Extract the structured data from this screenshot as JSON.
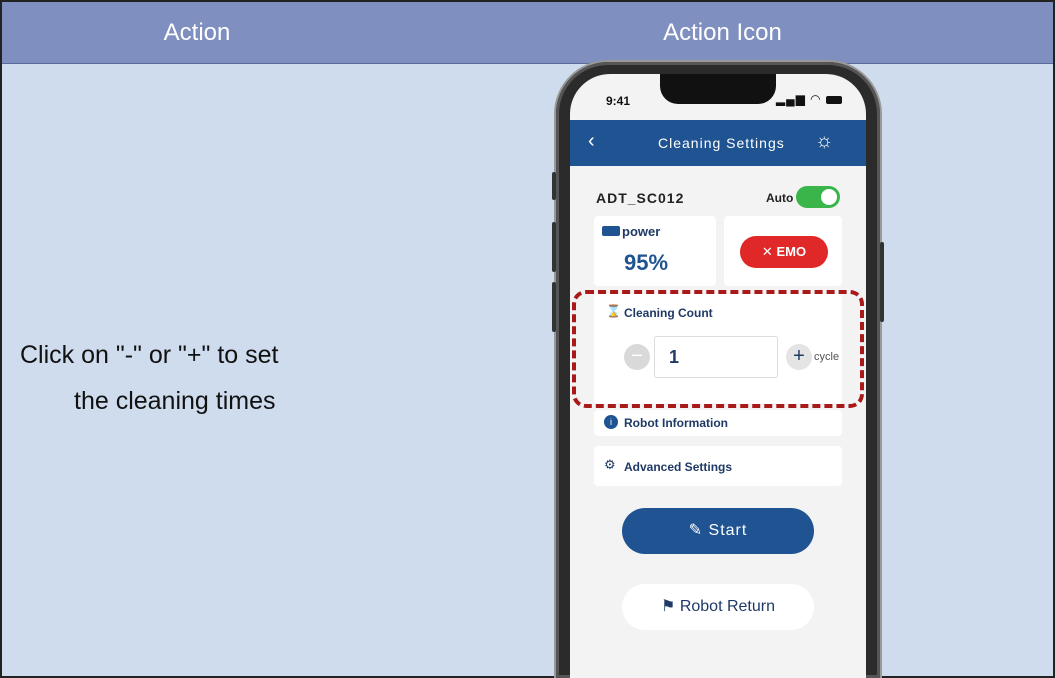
{
  "table": {
    "header_action": "Action",
    "header_icon": "Action Icon",
    "instruction_line1": "Click on \"-\" or \"+\" to set",
    "instruction_line2": "the cleaning times"
  },
  "phone": {
    "status_time": "9:41",
    "nav": {
      "back_glyph": "‹",
      "title": "Cleaning Settings",
      "sun_glyph": "☼"
    },
    "device_name": "ADT_SC012",
    "auto_label": "Auto",
    "power": {
      "label": "power",
      "value": "95%"
    },
    "emo_label": "EMO",
    "cleaning_count": {
      "label": "Cleaning Count",
      "minus": "−",
      "value": "1",
      "plus": "+",
      "unit": "cycle"
    },
    "robot_info_label": "Robot Information",
    "advanced_settings_label": "Advanced Settings",
    "start_label": "Start",
    "return_label": "Robot Return"
  },
  "colors": {
    "header_bg": "#7f8fc0",
    "table_bg": "#cfdcee",
    "nav_blue": "#1f5391",
    "emo_red": "#e02828",
    "toggle_green": "#3ab54a",
    "highlight_red": "#a81a1a"
  }
}
